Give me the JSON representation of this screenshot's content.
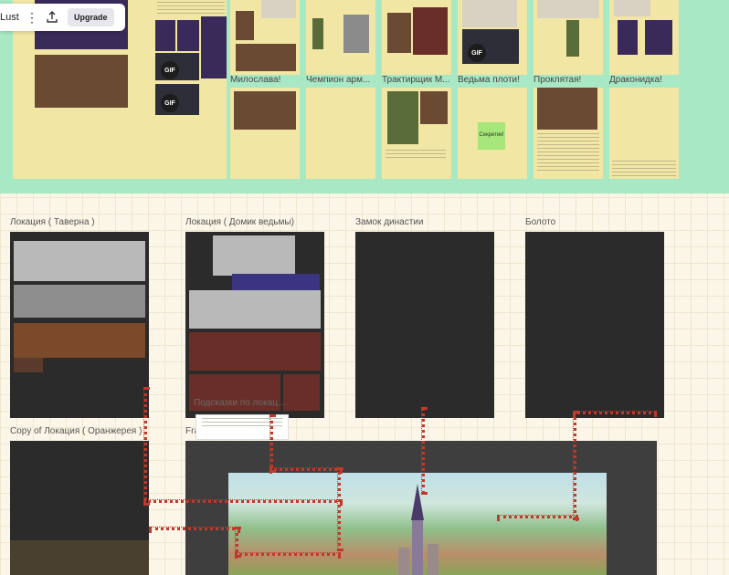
{
  "toolbar": {
    "board_name": "Lust",
    "more_icon": "more-vertical-icon",
    "share_icon": "share-upload-icon",
    "upgrade_label": "Upgrade"
  },
  "board": {
    "gif_label": "GIF",
    "cards": [
      {
        "title": "Милослава!"
      },
      {
        "title": "Чемпион арм..."
      },
      {
        "title": "Трактирщик М..."
      },
      {
        "title": "Ведьма плоти!"
      },
      {
        "title": "Проклятая!"
      },
      {
        "title": "Драконидка!"
      }
    ],
    "sticky_label": "Секретик!"
  },
  "frames": [
    {
      "label": "Локация ( Таверна )"
    },
    {
      "label": "Локация ( Домик ведьмы)"
    },
    {
      "label": "Замок династии"
    },
    {
      "label": "Болото"
    },
    {
      "label": "Copy of Локация ( Оранжерея )"
    },
    {
      "label": "Frame 2"
    }
  ],
  "overlay_text": "Подсказки по локац...",
  "colors": {
    "board_bg": "#a8e8c4",
    "card_bg": "#f1e6a3",
    "frame_bg": "#2b2b2b",
    "connector": "#c0392b"
  }
}
